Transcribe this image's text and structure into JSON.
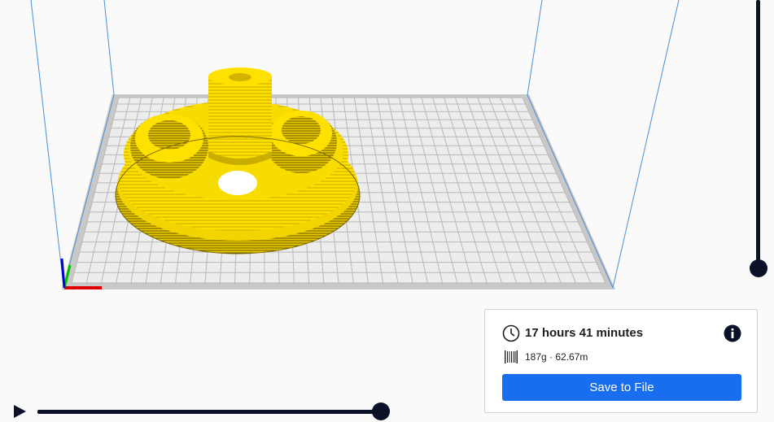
{
  "print_info": {
    "time_icon": "clock-icon",
    "print_time": "17 hours 41 minutes",
    "material_icon": "filament-spool-icon",
    "material": "187g · 62.67m",
    "info_icon": "info-icon",
    "save_label": "Save to File"
  },
  "controls": {
    "play_icon": "play-icon",
    "layer_slider_position": 1.0,
    "simulation_progress": 1.0
  },
  "scene": {
    "model_icon": "printed-part-model",
    "model_color": "#ffe100",
    "axis_colors": {
      "x": "#e00000",
      "y": "#00c000",
      "z": "#0000e0"
    },
    "build_volume_color": "#4a90d9",
    "accent_color": "#196ef0"
  }
}
